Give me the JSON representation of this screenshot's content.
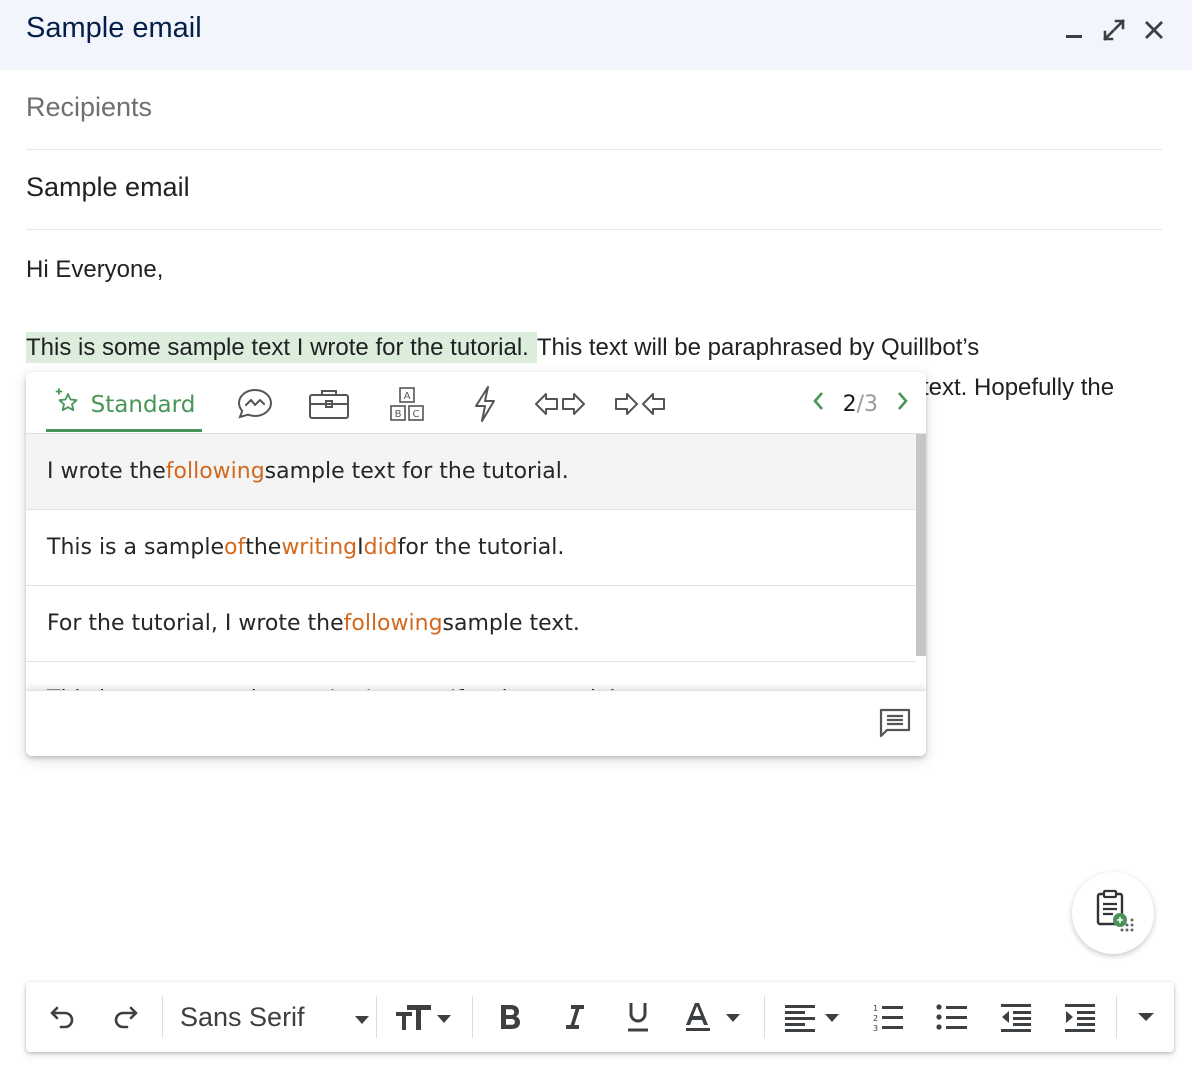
{
  "window": {
    "title": "Sample email",
    "controls": [
      "minimize-icon",
      "expand-icon",
      "close-icon"
    ]
  },
  "compose": {
    "recipients_placeholder": "Recipients",
    "subject": "Sample email",
    "greeting": "Hi Everyone,",
    "line1_highlighted": "This is some sample text I wrote for the tutorial.",
    "line1_rest": "This text will be paraphrased by Quillbot’s",
    "line2_visible": "text. Hopefully the"
  },
  "quillbot": {
    "modes": [
      {
        "icon": "sparkle-star-icon",
        "label": "Standard",
        "active": true
      },
      {
        "icon": "chat-bubble-icon"
      },
      {
        "icon": "briefcase-icon"
      },
      {
        "icon": "abc-blocks-icon"
      },
      {
        "icon": "lightning-icon"
      },
      {
        "icon": "expand-arrows-icon"
      },
      {
        "icon": "shorten-arrows-icon"
      }
    ],
    "pager": {
      "current": "2",
      "total": "/3"
    },
    "results": [
      {
        "parts": [
          {
            "t": "I wrote the "
          },
          {
            "t": "following",
            "c": true
          },
          {
            "t": " sample text for the tutorial."
          }
        ]
      },
      {
        "parts": [
          {
            "t": "This is a sample "
          },
          {
            "t": "of",
            "c": true
          },
          {
            "t": " the "
          },
          {
            "t": "writing",
            "c": true
          },
          {
            "t": " I "
          },
          {
            "t": "did",
            "c": true
          },
          {
            "t": " for the tutorial."
          }
        ]
      },
      {
        "parts": [
          {
            "t": "For the tutorial, I wrote the "
          },
          {
            "t": "following",
            "c": true
          },
          {
            "t": " sample text."
          }
        ]
      },
      {
        "parts": [
          {
            "t": "This is some sample text "
          },
          {
            "t": "that",
            "c": true
          },
          {
            "t": " I "
          },
          {
            "t": "created",
            "c": true
          },
          {
            "t": " for the tutorial."
          }
        ]
      }
    ],
    "feedback_icon": "feedback-icon",
    "colors": {
      "accent": "#499557",
      "changed": "#d2691e"
    }
  },
  "fab": {
    "icon": "quillbot-clipboard-icon"
  },
  "toolbar": {
    "font_name": "Sans Serif",
    "items": [
      "undo-icon",
      "redo-icon",
      "font-select",
      "text-size-icon",
      "bold-icon",
      "italic-icon",
      "underline-icon",
      "text-color-icon",
      "align-icon",
      "numbered-list-icon",
      "bulleted-list-icon",
      "indent-less-icon",
      "indent-more-icon",
      "more-formatting-icon"
    ]
  }
}
